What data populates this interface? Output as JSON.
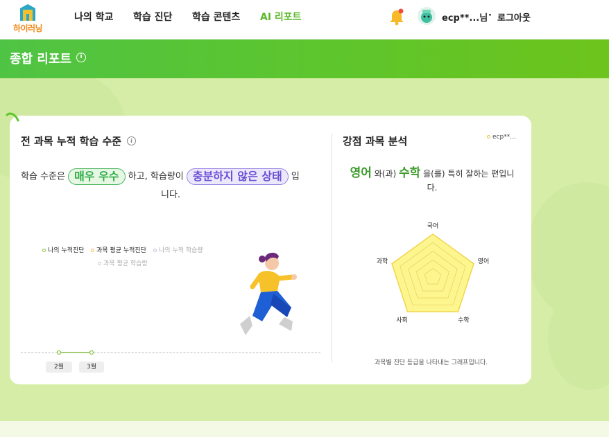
{
  "header": {
    "logo_text": "하이러닝",
    "nav": [
      {
        "label": "나의 학교",
        "active": false
      },
      {
        "label": "학습 진단",
        "active": false
      },
      {
        "label": "학습 콘텐츠",
        "active": false
      },
      {
        "label": "AI 리포트",
        "active": true
      }
    ],
    "user_name": "ecp**...님",
    "separator": "·",
    "logout_label": "로그아웃"
  },
  "banner": {
    "title": "종합 리포트",
    "info_icon": "i"
  },
  "cumulative": {
    "title": "전 과목 누적 학습 수준",
    "info_icon": "i",
    "sentence": {
      "prefix": "학습 수준은",
      "level": "매우 우수",
      "mid": "하고, 학습량이",
      "amount": "충분하지 않은 상태",
      "suffix": "입",
      "suffix_line2": "니다."
    },
    "legend": [
      {
        "label": "나의 누적진단",
        "color": "#8bc34a"
      },
      {
        "label": "과목 평균 누적진단",
        "color": "#ffb74d"
      },
      {
        "label": "나의 누적 학습량",
        "color": "#b8c4d8"
      },
      {
        "label": "과목 평균 학습량",
        "color": "#c8c8c8"
      }
    ],
    "months": [
      "2월",
      "3월"
    ]
  },
  "strengths": {
    "title": "강점 과목 분석",
    "user_tag": "ecp**...",
    "subject1": "영어",
    "conj": "와(과)",
    "subject2": "수학",
    "rest": "을(를) 특히 잘하는 편입니",
    "rest_line2": "다.",
    "radar_labels": [
      "국어",
      "영어",
      "수학",
      "사회",
      "과학"
    ],
    "radar_values": [
      1,
      1,
      1,
      1,
      1
    ],
    "caption": "과목별 진단 등급을 나타내는 그래프입니다.",
    "colors": {
      "fill": "#fdf68f",
      "stroke": "#f2d44b",
      "grid": "#e0c850"
    }
  }
}
